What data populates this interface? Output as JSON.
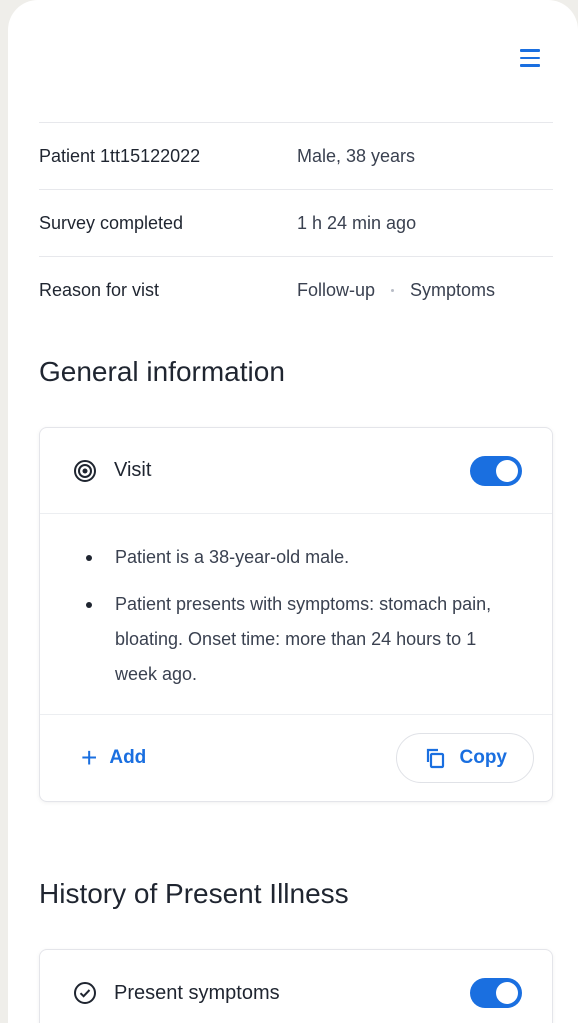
{
  "patient_info": [
    {
      "label": "Patient 1tt15122022",
      "value": "Male, 38 years"
    },
    {
      "label": "Survey completed",
      "value": "1 h 24 min ago"
    },
    {
      "label": "Reason for vist",
      "tags": [
        "Follow-up",
        "Symptoms"
      ]
    }
  ],
  "general_information": {
    "title": "General information",
    "card": {
      "title": "Visit",
      "icon": "target-icon",
      "toggle_on": true,
      "bullets": [
        "Patient is a 38-year-old male.",
        "Patient presents with symptoms: stomach pain, bloating. Onset time: more than 24 hours to 1 week ago."
      ],
      "add_label": "Add",
      "copy_label": "Copy"
    }
  },
  "history": {
    "title": "History of Present Illness",
    "card": {
      "title": "Present symptoms",
      "icon": "check-circle-icon",
      "toggle_on": true
    }
  },
  "colors": {
    "accent": "#1a6fe0",
    "background": "#efeeea"
  }
}
